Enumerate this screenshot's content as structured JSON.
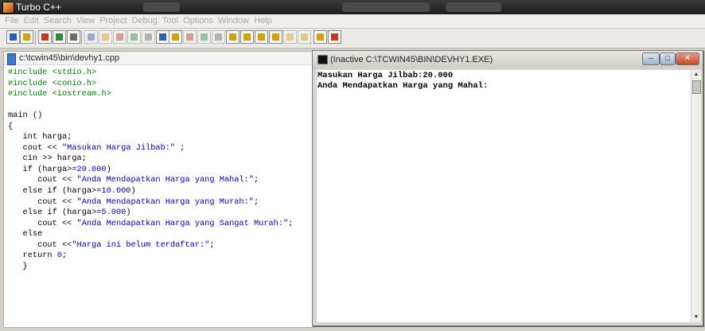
{
  "app": {
    "title": "Turbo C++"
  },
  "menu": [
    "File",
    "Edit",
    "Search",
    "View",
    "Project",
    "Debug",
    "Tool",
    "Options",
    "Window",
    "Help"
  ],
  "toolbar": {
    "icons": [
      "open-project-icon",
      "save-icon",
      "compile-icon",
      "make-icon",
      "build-icon",
      "run-icon",
      "step-over-icon",
      "trace-into-icon",
      "go-to-cursor-icon",
      "toggle-breakpoint-icon",
      "evaluate-icon",
      "undo-icon",
      "cut-icon",
      "copy-icon",
      "paste-icon",
      "search-icon",
      "replace-icon",
      "search-again-icon",
      "find-next-icon",
      "next-message-icon",
      "previous-message-icon",
      "tile-windows-icon",
      "cascade-windows-icon"
    ],
    "accent": "#d4a017"
  },
  "editor": {
    "filename": "c:\\tcwin45\\bin\\devhy1.cpp",
    "lines": [
      [
        [
          "pp",
          "#include <stdio.h>"
        ]
      ],
      [
        [
          "pp",
          "#include <conio.h>"
        ]
      ],
      [
        [
          "pp",
          "#include <iostream.h>"
        ]
      ],
      [],
      [
        [
          "t",
          "main ()"
        ]
      ],
      [
        [
          "t",
          "{"
        ]
      ],
      [
        [
          "t",
          "   int harga;"
        ]
      ],
      [
        [
          "t",
          "   cout << "
        ],
        [
          "str",
          "\"Masukan Harga Jilbab:\""
        ],
        [
          "t",
          " ;"
        ]
      ],
      [
        [
          "t",
          "   cin >> harga;"
        ]
      ],
      [
        [
          "t",
          "   if (harga>="
        ],
        [
          "num",
          "20.000"
        ],
        [
          "t",
          ")"
        ]
      ],
      [
        [
          "t",
          "      cout << "
        ],
        [
          "str",
          "\"Anda Mendapatkan Harga yang Mahal:\""
        ],
        [
          "t",
          ";"
        ]
      ],
      [
        [
          "t",
          "   else if (harga>="
        ],
        [
          "num",
          "10.000"
        ],
        [
          "t",
          ")"
        ]
      ],
      [
        [
          "t",
          "      cout << "
        ],
        [
          "str",
          "\"Anda Mendapatkan Harga yang Murah:\""
        ],
        [
          "t",
          ";"
        ]
      ],
      [
        [
          "t",
          "   else if (harga>="
        ],
        [
          "num",
          "5.000"
        ],
        [
          "t",
          ")"
        ]
      ],
      [
        [
          "t",
          "      cout << "
        ],
        [
          "str",
          "\"Anda Mendapatkan Harga yang Sangat Murah:\""
        ],
        [
          "t",
          ";"
        ]
      ],
      [
        [
          "t",
          "   else"
        ]
      ],
      [
        [
          "t",
          "      cout <<"
        ],
        [
          "str",
          "\"Harga ini belum terdaftar:\""
        ],
        [
          "t",
          ";"
        ]
      ],
      [
        [
          "t",
          "   return "
        ],
        [
          "num",
          "0"
        ],
        [
          "t",
          ";"
        ]
      ],
      [
        [
          "t",
          "   }"
        ]
      ]
    ],
    "colors": {
      "preprocessor": "#007a00",
      "string": "#0000c8",
      "number": "#0000c8"
    }
  },
  "console": {
    "title": "(Inactive C:\\TCWIN45\\BIN\\DEVHY1.EXE)",
    "output": [
      "Masukan Harga Jilbab:20.000",
      "Anda Mendapatkan Harga yang Mahal:"
    ],
    "buttons": {
      "minimize": "–",
      "maximize": "□",
      "close": "✕"
    }
  }
}
